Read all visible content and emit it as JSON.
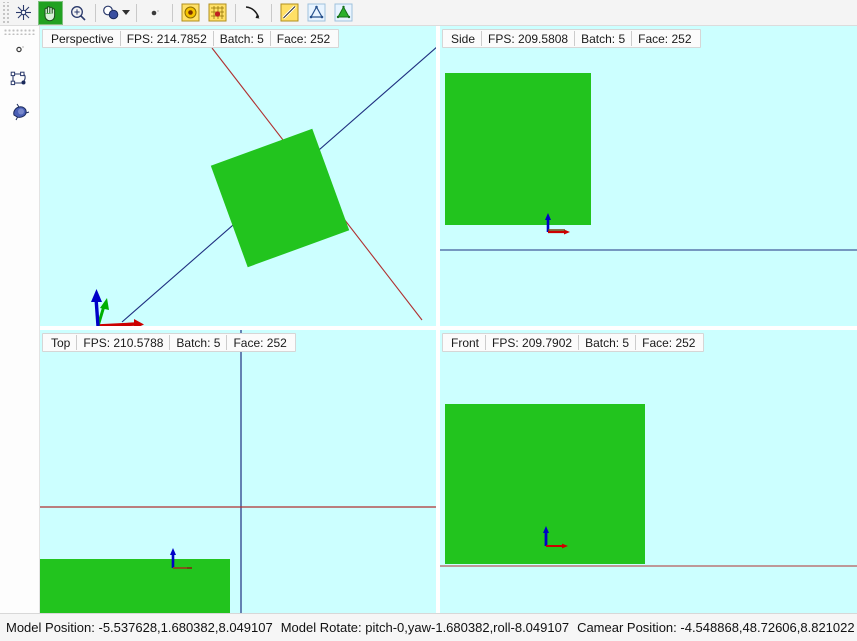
{
  "toolbar": {
    "buttons": [
      {
        "name": "move-tool",
        "icon": "move-axes-icon",
        "label": "Move",
        "active": false
      },
      {
        "name": "pan-tool",
        "icon": "hand-pan-icon",
        "label": "Pan",
        "active": true
      },
      {
        "name": "zoom-tool",
        "icon": "magnifier-icon",
        "label": "Zoom",
        "active": false
      },
      {
        "name": "select-objects-tool",
        "icon": "spheres-select-icon",
        "label": "Select Objects",
        "active": false,
        "dropdown": true
      },
      {
        "name": "point-tool",
        "icon": "small-dot-icon",
        "label": "Point",
        "active": false
      },
      {
        "name": "sphere-tool",
        "icon": "sphere-yellow-icon",
        "label": "Sphere",
        "active": false
      },
      {
        "name": "texture-tool",
        "icon": "texture-grid-icon",
        "label": "Texture",
        "active": false
      },
      {
        "name": "curve-tool",
        "icon": "curve-icon",
        "label": "Curve",
        "active": false
      },
      {
        "name": "line-tool",
        "icon": "line-diagonal-icon",
        "label": "Line",
        "active": false
      },
      {
        "name": "triangle-tool",
        "icon": "triangle-outline-icon",
        "label": "Triangle",
        "active": false
      },
      {
        "name": "mesh-tool",
        "icon": "triangle-filled-icon",
        "label": "Mesh",
        "active": false
      }
    ]
  },
  "left_rail": {
    "buttons": [
      {
        "name": "vertex-tool",
        "icon": "vertex-dot-icon",
        "label": "Vertex"
      },
      {
        "name": "shape-edit-tool",
        "icon": "shape-nodes-icon",
        "label": "Shape Edit"
      },
      {
        "name": "paint-tool",
        "icon": "paint-blob-icon",
        "label": "Paint"
      }
    ]
  },
  "viewports": [
    {
      "name": "perspective",
      "title": "Perspective",
      "fps_label": "FPS: 214.7852",
      "batch_label": "Batch: 5",
      "face_label": "Face: 252"
    },
    {
      "name": "side",
      "title": "Side",
      "fps_label": "FPS: 209.5808",
      "batch_label": "Batch: 5",
      "face_label": "Face: 252"
    },
    {
      "name": "top",
      "title": "Top",
      "fps_label": "FPS: 210.5788",
      "batch_label": "Batch: 5",
      "face_label": "Face: 252"
    },
    {
      "name": "front",
      "title": "Front",
      "fps_label": "FPS: 209.7902",
      "batch_label": "Batch: 5",
      "face_label": "Face: 252"
    }
  ],
  "status": {
    "model_position": "Model Position: -5.537628,1.680382,8.049107",
    "model_rotate": "Model Rotate: pitch-0,yaw-1.680382,roll-8.049107",
    "camera_position": "Camear Position: -4.548868,48.72606,8.821022"
  },
  "colors": {
    "viewport_background": "#ccffff",
    "mesh_green": "#22c41e",
    "axis_x_red": "#c00000",
    "axis_y_green": "#00b000",
    "axis_z_blue": "#0000c8",
    "toolbar_active": "#21a121",
    "grid_line_red": "#b03030",
    "grid_line_blue": "#203080"
  }
}
